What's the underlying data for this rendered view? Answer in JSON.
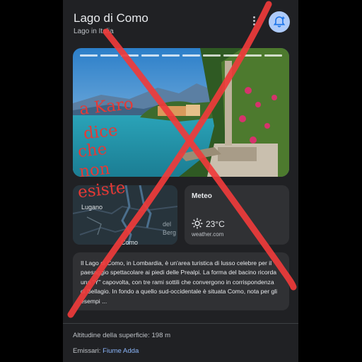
{
  "header": {
    "title": "Lago di Como",
    "subtitle": "Lago in Italia"
  },
  "map": {
    "labels": [
      "Lugano",
      "del",
      "Berg",
      "Como"
    ]
  },
  "weather": {
    "title": "Meteo",
    "temp": "23°C",
    "source": "weather.com"
  },
  "description": {
    "text": "Il Lago di Como, in Lombardia, è un'area turistica di lusso celebre per il paesaggio spettacolare ai piedi delle Prealpi. La forma del bacino ricorda una \"Y\" capovolta, con tre rami sottili che convergono in corrispondenza di Bellagio. In fondo a quello sud-occidentale è situata Como, nota per gli esempi ..."
  },
  "facts": [
    {
      "label": "Altitudine della superficie:",
      "value": "198 m"
    },
    {
      "label": "Emissari:",
      "value": "Fiume Adda"
    }
  ],
  "annotation": {
    "lines": [
      "a Karo",
      "dice",
      "che",
      "non",
      "esiste"
    ]
  },
  "colors": {
    "panel": "#202124",
    "card": "#303134",
    "link": "#8ab4f8",
    "ink": "#e53935"
  }
}
